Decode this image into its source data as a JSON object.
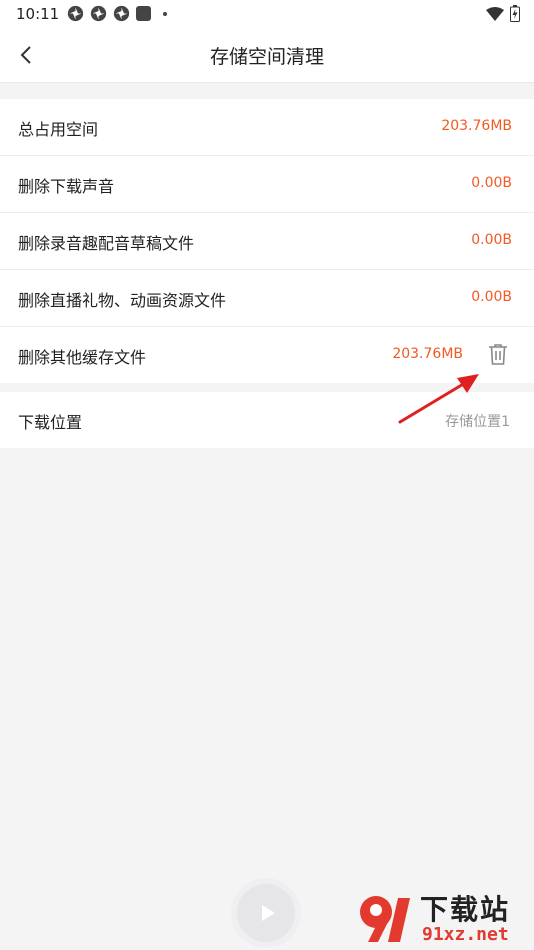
{
  "status_bar": {
    "time": "10:11"
  },
  "nav": {
    "title": "存储空间清理"
  },
  "storage_rows": [
    {
      "label": "总占用空间",
      "value": "203.76MB"
    },
    {
      "label": "删除下载声音",
      "value": "0.00B"
    },
    {
      "label": "删除录音趣配音草稿文件",
      "value": "0.00B"
    },
    {
      "label": "删除直播礼物、动画资源文件",
      "value": "0.00B"
    },
    {
      "label": "删除其他缓存文件",
      "value": "203.76MB"
    }
  ],
  "download_location": {
    "label": "下载位置",
    "value": "存储位置1"
  },
  "watermark": {
    "title": "下载站",
    "url": "91xz.net"
  },
  "colors": {
    "accent": "#f25a24",
    "background": "#f4f4f5",
    "annotation": "#e02020"
  },
  "icons": [
    "back-arrow-icon",
    "trash-icon",
    "play-icon",
    "wifi-icon",
    "battery-icon"
  ]
}
